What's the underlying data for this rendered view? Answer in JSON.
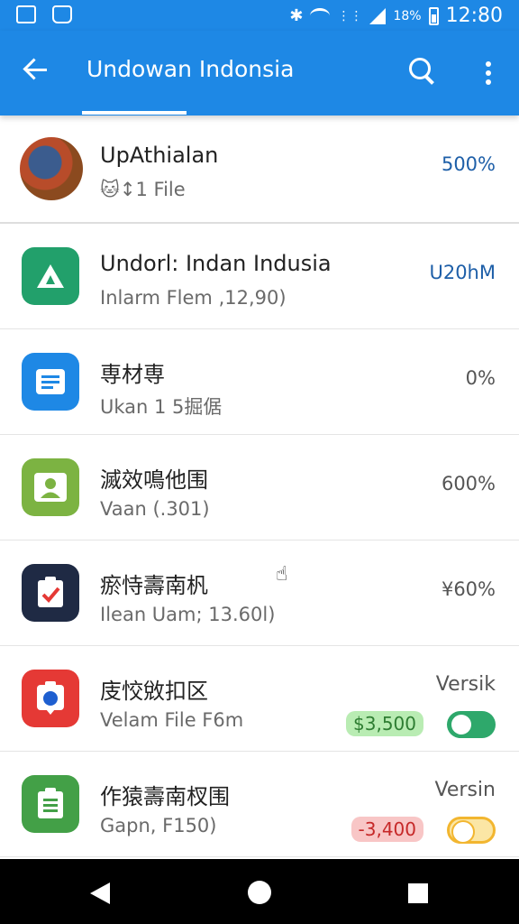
{
  "status_bar": {
    "battery": "18%",
    "time": "12:80",
    "icons": [
      "image-icon",
      "bag-icon",
      "bluetooth-icon",
      "wifi-icon",
      "vibrate-icon",
      "signal-icon",
      "battery-icon"
    ]
  },
  "app_bar": {
    "title": "Undowan Indonsia",
    "icons": [
      "back-arrow-icon",
      "search-icon",
      "more-vert-icon"
    ]
  },
  "items": [
    {
      "name": "UpAthialan",
      "sub": "🐱↕1 File",
      "value": "500%",
      "icon": "phone-photo-icon",
      "icon_bg": "#b84c2a"
    },
    {
      "name": "Undorl: Indan Indusia",
      "sub": "Inlarm Flem ,12,90)",
      "value": "U20hM",
      "icon": "triangle-logo-icon",
      "icon_bg": "#22a06b"
    },
    {
      "name": "専材専",
      "sub": "Ukan 1 5掘倨",
      "value": "0%",
      "icon": "document-icon",
      "icon_bg": "#1e88e5"
    },
    {
      "name": "滅效鳴他围",
      "sub": "Vaan (.301)",
      "value": "600%",
      "icon": "person-icon",
      "icon_bg": "#7cb342"
    },
    {
      "name": "瘀恃壽南杋",
      "sub": "Ilean Uam; 13.60l)",
      "value": "¥60%",
      "icon": "checklist-icon",
      "icon_bg": "#1f2a44"
    },
    {
      "name": "庋恔敓扣区",
      "sub": "Velam File F6m",
      "label": "Versik",
      "pill": "$3,500",
      "pill_color": "green",
      "toggle": "on",
      "icon": "location-icon",
      "icon_bg": "#e53935"
    },
    {
      "name": "作猿壽南杈围",
      "sub": "Gapn, F150)",
      "label": "Versin",
      "pill": "-3,400",
      "pill_color": "red",
      "toggle": "off",
      "icon": "clipboard-icon",
      "icon_bg": "#43a047"
    }
  ],
  "nav_bar": {
    "icons": [
      "back-triangle-icon",
      "home-circle-icon",
      "recent-square-icon"
    ]
  },
  "colors": {
    "primary": "#1e88e5",
    "toggle_on": "#2ea86b",
    "toggle_off": "#f2b630"
  }
}
